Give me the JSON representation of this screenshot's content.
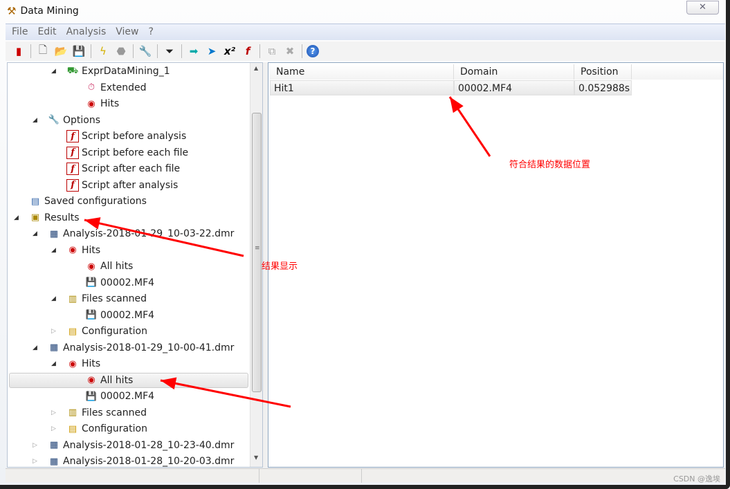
{
  "window": {
    "title": "Data Mining",
    "close_glyph": "✕"
  },
  "menu": [
    "File",
    "Edit",
    "Analysis",
    "View",
    "?"
  ],
  "toolbar": [
    {
      "icon": "exit-icon",
      "glyph": "▮",
      "color": "#c00"
    },
    "sep",
    {
      "icon": "new-file-icon",
      "glyph": "🗋",
      "color": "#555"
    },
    {
      "icon": "open-folder-icon",
      "glyph": "📂",
      "color": "#d9a400"
    },
    {
      "icon": "save-icon",
      "glyph": "💾",
      "color": "#336"
    },
    "sep",
    {
      "icon": "run-lightning-icon",
      "glyph": "ϟ",
      "color": "#d4b000"
    },
    {
      "icon": "stop-icon",
      "glyph": "⬣",
      "color": "#999"
    },
    "sep",
    {
      "icon": "wrench-icon",
      "glyph": "🔧",
      "color": "#888"
    },
    "sep",
    {
      "icon": "filter-export-icon",
      "glyph": "⏷",
      "color": "#222"
    },
    "sep",
    {
      "icon": "export-icon",
      "glyph": "➡",
      "color": "#0aa"
    },
    {
      "icon": "export-plot-icon",
      "glyph": "➤",
      "color": "#07c"
    },
    {
      "icon": "export-formula-icon",
      "glyph": "x²",
      "color": "#000"
    },
    {
      "icon": "export-script-icon",
      "glyph": "f",
      "color": "#b00"
    },
    "sep",
    {
      "icon": "copy-icon",
      "glyph": "⧉",
      "color": "#aaa"
    },
    {
      "icon": "delete-icon",
      "glyph": "✖",
      "color": "#aaa"
    },
    "sep",
    {
      "icon": "help-icon",
      "glyph": "?",
      "color": "#fff"
    }
  ],
  "tree": [
    {
      "label": "ExprDataMining_1",
      "level": 2,
      "exp": "open",
      "icon": "datamining-icon",
      "glyph": "⛟",
      "color": "#393"
    },
    {
      "label": "Extended",
      "level": 3,
      "icon": "extended-icon",
      "glyph": "⏱",
      "color": "#c36"
    },
    {
      "label": "Hits",
      "level": 3,
      "icon": "target-icon",
      "glyph": "◉",
      "color": "#c00"
    },
    {
      "label": "Options",
      "level": 1,
      "exp": "open",
      "icon": "wrench-icon",
      "glyph": "🔧",
      "color": "#777"
    },
    {
      "label": "Script before analysis",
      "level": 2,
      "icon": "script-icon",
      "glyph": "f",
      "color": "#b00"
    },
    {
      "label": "Script before each file",
      "level": 2,
      "icon": "script-icon",
      "glyph": "f",
      "color": "#b00"
    },
    {
      "label": "Script after each file",
      "level": 2,
      "icon": "script-icon",
      "glyph": "f",
      "color": "#b00"
    },
    {
      "label": "Script after analysis",
      "level": 2,
      "icon": "script-icon",
      "glyph": "f",
      "color": "#b00"
    },
    {
      "label": "Saved configurations",
      "level": 0,
      "icon": "saved-config-icon",
      "glyph": "▤",
      "color": "#36a"
    },
    {
      "label": "Results",
      "level": 0,
      "exp": "open",
      "icon": "results-icon",
      "glyph": "▣",
      "color": "#a80"
    },
    {
      "label": "Analysis-2018-01-29_10-03-22.dmr",
      "level": 1,
      "exp": "open",
      "icon": "analysis-file-icon",
      "glyph": "▦",
      "color": "#247"
    },
    {
      "label": "Hits",
      "level": 2,
      "exp": "open",
      "icon": "target-icon",
      "glyph": "◉",
      "color": "#c00"
    },
    {
      "label": "All hits",
      "level": 3,
      "icon": "target-icon",
      "glyph": "◉",
      "color": "#c00"
    },
    {
      "label": "00002.MF4",
      "level": 3,
      "icon": "mf4-file-icon",
      "glyph": "💾",
      "color": "#33a"
    },
    {
      "label": "Files scanned",
      "level": 2,
      "exp": "open",
      "icon": "files-scanned-icon",
      "glyph": "▥",
      "color": "#a80"
    },
    {
      "label": "00002.MF4",
      "level": 3,
      "icon": "mf4-file-icon",
      "glyph": "💾",
      "color": "#33a"
    },
    {
      "label": "Configuration",
      "level": 2,
      "exp": "closed",
      "icon": "configuration-icon",
      "glyph": "▤",
      "color": "#c90"
    },
    {
      "label": "Analysis-2018-01-29_10-00-41.dmr",
      "level": 1,
      "exp": "open",
      "icon": "analysis-file-icon",
      "glyph": "▦",
      "color": "#247"
    },
    {
      "label": "Hits",
      "level": 2,
      "exp": "open",
      "icon": "target-icon",
      "glyph": "◉",
      "color": "#c00"
    },
    {
      "label": "All hits",
      "level": 3,
      "icon": "target-icon",
      "glyph": "◉",
      "color": "#c00",
      "selected": true
    },
    {
      "label": "00002.MF4",
      "level": 3,
      "icon": "mf4-file-icon",
      "glyph": "💾",
      "color": "#33a"
    },
    {
      "label": "Files scanned",
      "level": 2,
      "exp": "closed",
      "icon": "files-scanned-icon",
      "glyph": "▥",
      "color": "#a80"
    },
    {
      "label": "Configuration",
      "level": 2,
      "exp": "closed",
      "icon": "configuration-icon",
      "glyph": "▤",
      "color": "#c90"
    },
    {
      "label": "Analysis-2018-01-28_10-23-40.dmr",
      "level": 1,
      "exp": "closed",
      "icon": "analysis-file-icon",
      "glyph": "▦",
      "color": "#247"
    },
    {
      "label": "Analysis-2018-01-28_10-20-03.dmr",
      "level": 1,
      "exp": "closed",
      "icon": "analysis-file-icon",
      "glyph": "▦",
      "color": "#247"
    }
  ],
  "table": {
    "columns": [
      "Name",
      "Domain",
      "Position"
    ],
    "rows": [
      [
        "Hit1",
        "00002.MF4",
        "0.052988s"
      ]
    ]
  },
  "annotations": {
    "data_position": "符合结果的数据位置",
    "result_display": "结果显示",
    "arrow_color": "#ff0000"
  },
  "watermark": "CSDN @逸埃"
}
